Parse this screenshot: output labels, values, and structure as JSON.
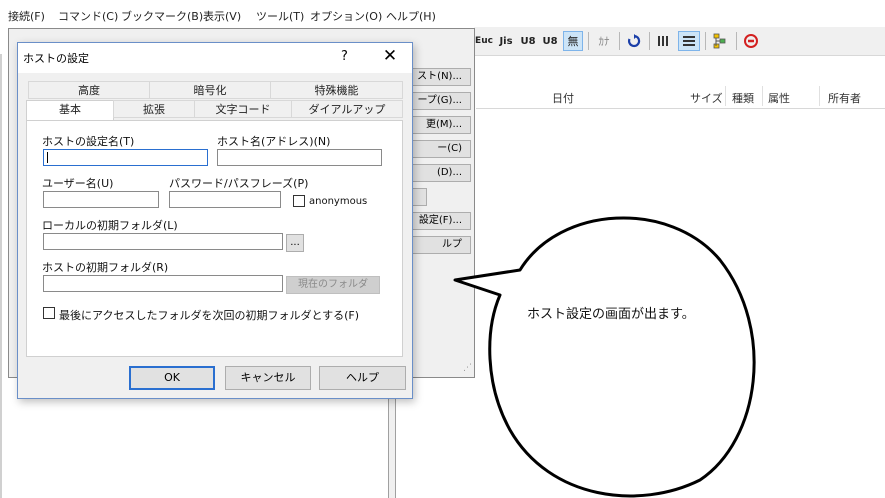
{
  "menu": [
    "接続(F)",
    "コマンド(C)",
    "ブックマーク(B)",
    "表示(V)",
    "ツール(T)",
    "オプション(O)",
    "ヘルプ(H)"
  ],
  "toolbar": {
    "items": [
      "Euc",
      "Jis",
      "U8",
      "U8",
      "無",
      "ｶﾅ"
    ],
    "background_close": "×"
  },
  "bg_window": {
    "buttons": [
      "スト(N)...",
      "ープ(G)...",
      "更(M)...",
      "ー(C)",
      "(D)...",
      "",
      "設定(F)...",
      "ルプ"
    ]
  },
  "file_list": {
    "columns": [
      "日付",
      "サイズ",
      "種類",
      "属性",
      "所有者"
    ]
  },
  "dialog": {
    "title": "ホストの設定",
    "help_glyph": "?",
    "close_glyph": "✕",
    "tabs_top": [
      "高度",
      "暗号化",
      "特殊機能"
    ],
    "tabs_bottom": [
      "基本",
      "拡張",
      "文字コード",
      "ダイアルアップ"
    ],
    "fields": {
      "host_setting_name_label": "ホストの設定名(T)",
      "host_setting_name_value": "",
      "host_name_label": "ホスト名(アドレス)(N)",
      "host_name_value": "",
      "username_label": "ユーザー名(U)",
      "username_value": "",
      "password_label": "パスワード/パスフレーズ(P)",
      "password_value": "",
      "anonymous_label": "anonymous",
      "local_folder_label": "ローカルの初期フォルダ(L)",
      "local_folder_value": "",
      "browse_label": "...",
      "host_folder_label": "ホストの初期フォルダ(R)",
      "host_folder_value": "",
      "current_folder_button": "現在のフォルダ",
      "last_folder_checkbox_label": "最後にアクセスしたフォルダを次回の初期フォルダとする(F)"
    },
    "buttons": {
      "ok": "OK",
      "cancel": "キャンセル",
      "help": "ヘルプ"
    }
  },
  "annotation": {
    "text": "ホスト設定の画面が出ます。"
  }
}
